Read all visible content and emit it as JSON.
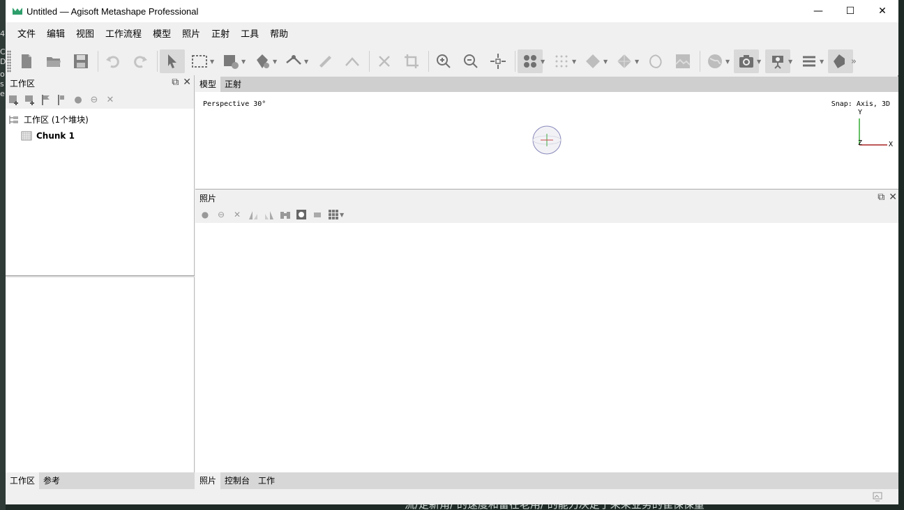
{
  "desktop": {
    "left_fragments": [
      "4",
      "C",
      "DF",
      "o",
      "s",
      "e"
    ],
    "bottom_text": "流/定新角/ 的速度和雷在老用/ 的能力决定了采采业务的隹保保量"
  },
  "window": {
    "title": "Untitled — Agisoft Metashape Professional",
    "minimize": "—",
    "maximize": "☐",
    "close": "✕"
  },
  "menu": [
    "文件",
    "编辑",
    "视图",
    "工作流程",
    "模型",
    "照片",
    "正射",
    "工具",
    "帮助"
  ],
  "toolbar": {
    "overflow": "»"
  },
  "workspace": {
    "title": "工作区",
    "restore": "⧉",
    "close": "✕",
    "tree_root": "工作区 (1个堆块)",
    "chunk": "Chunk 1"
  },
  "left_tabs": [
    "工作区",
    "参考"
  ],
  "model_tabs": [
    "模型",
    "正射"
  ],
  "viewport": {
    "perspective": "Perspective 30°",
    "snap": "Snap: Axis, 3D",
    "axis_y": "Y",
    "axis_x": "X",
    "axis_z": "Z"
  },
  "photos": {
    "title": "照片",
    "restore": "⧉",
    "close": "✕"
  },
  "bottom_tabs": [
    "照片",
    "控制台",
    "工作"
  ]
}
